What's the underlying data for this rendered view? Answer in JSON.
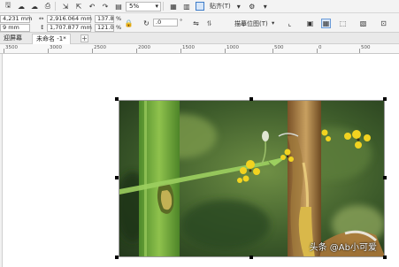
{
  "toolbar": {
    "zoom_value": "5%",
    "paste_label": "贴齐(T)",
    "icons": [
      "save-icon",
      "cloud-download-icon",
      "cloud-upload-icon",
      "print-icon",
      "import-icon",
      "export-icon",
      "undo-icon",
      "redo-icon",
      "publish-pdf-icon",
      "fullscreen-icon",
      "snap-icon",
      "settings-icon"
    ]
  },
  "propbar": {
    "x_value": "4,231 mm",
    "y_value": "9 mm",
    "width_value": "2,916.064 mm",
    "height_value": "1,707.877 mm",
    "scale_x": "137.8",
    "scale_y": "121.0",
    "percent_sign": "%",
    "rotation_value": ".0",
    "degree_sign": "°",
    "trace_label": "描摹位图(T)"
  },
  "tabs": [
    {
      "label": "迎屏幕"
    },
    {
      "label": "未命名 -1*"
    }
  ],
  "ruler": {
    "labels": [
      "3500",
      "3000",
      "2500",
      "2000",
      "1500",
      "1000",
      "500",
      "0",
      "500"
    ]
  },
  "watermark": "头条 @Ab小可爱",
  "colors": {
    "accent": "#3d7cc9",
    "toolbar_bg": "#f3f3f3",
    "tab_bg": "#e9e9e9"
  }
}
